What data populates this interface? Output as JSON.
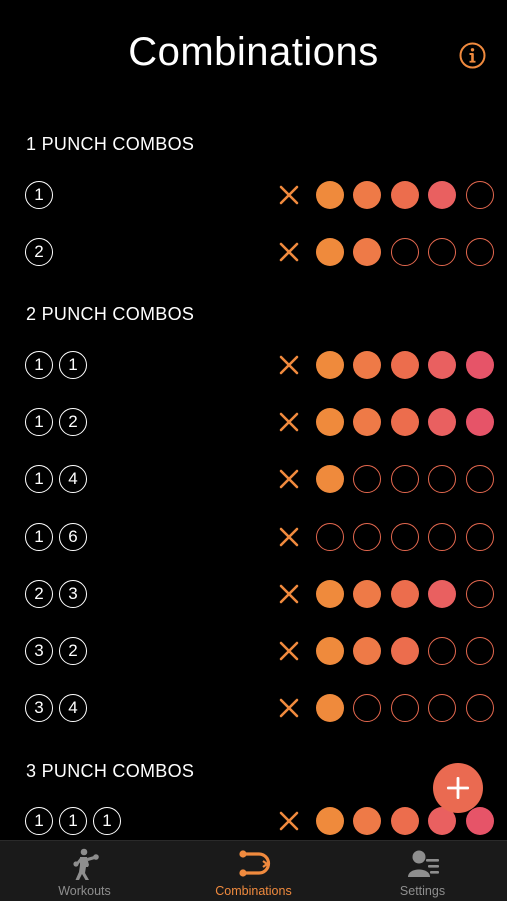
{
  "header": {
    "title": "Combinations",
    "info_icon": "info-icon"
  },
  "colors": {
    "accent": "#f08a3e",
    "empty_dot": "#e4684f",
    "dot_scale": [
      "#ef8a3c",
      "#ee7a47",
      "#ec6d4d",
      "#e96060",
      "#e65468"
    ]
  },
  "sections": [
    {
      "title": "1 PUNCH COMBOS",
      "rows": [
        {
          "punches": [
            "1"
          ],
          "rating": 4
        },
        {
          "punches": [
            "2"
          ],
          "rating": 2
        }
      ]
    },
    {
      "title": "2 PUNCH COMBOS",
      "rows": [
        {
          "punches": [
            "1",
            "1"
          ],
          "rating": 5
        },
        {
          "punches": [
            "1",
            "2"
          ],
          "rating": 5
        },
        {
          "punches": [
            "1",
            "4"
          ],
          "rating": 1
        },
        {
          "punches": [
            "1",
            "6"
          ],
          "rating": 0
        },
        {
          "punches": [
            "2",
            "3"
          ],
          "rating": 4
        },
        {
          "punches": [
            "3",
            "2"
          ],
          "rating": 3
        },
        {
          "punches": [
            "3",
            "4"
          ],
          "rating": 1
        }
      ]
    },
    {
      "title": "3 PUNCH COMBOS",
      "rows": [
        {
          "punches": [
            "1",
            "1",
            "1"
          ],
          "rating": 5
        }
      ]
    }
  ],
  "rating_max": 5,
  "fab": {
    "icon": "plus-icon"
  },
  "tabs": [
    {
      "label": "Workouts",
      "icon": "boxer-icon",
      "active": false
    },
    {
      "label": "Combinations",
      "icon": "combination-icon",
      "active": true
    },
    {
      "label": "Settings",
      "icon": "profile-settings-icon",
      "active": false
    }
  ]
}
